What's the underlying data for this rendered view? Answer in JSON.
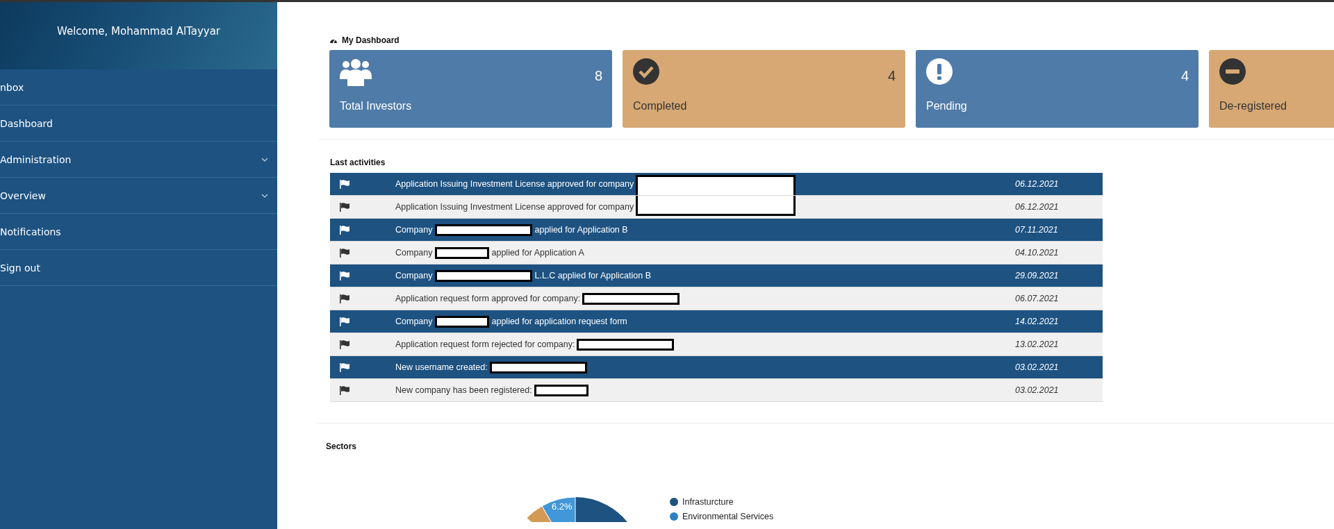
{
  "sidebar": {
    "welcome": "Welcome, Mohammad AlTayyar",
    "items": [
      {
        "label": "nbox",
        "has_submenu": false
      },
      {
        "label": "Dashboard",
        "has_submenu": false
      },
      {
        "label": "Administration",
        "has_submenu": true
      },
      {
        "label": "Overview",
        "has_submenu": true
      },
      {
        "label": "Notifications",
        "has_submenu": false
      },
      {
        "label": "Sign out",
        "has_submenu": false
      }
    ]
  },
  "dashboard": {
    "title": "My Dashboard",
    "cards": [
      {
        "kind": "users",
        "color": "#4f7ba8",
        "value": "8",
        "label": "Total Investors"
      },
      {
        "kind": "check",
        "color": "#d7a874",
        "value": "4",
        "label": "Completed"
      },
      {
        "kind": "alert",
        "color": "#4f7ba8",
        "value": "4",
        "label": "Pending"
      },
      {
        "kind": "minus",
        "color": "#d7a874",
        "label": "De-registered"
      }
    ]
  },
  "activities": {
    "title": "Last activities",
    "rows": [
      {
        "highlighted": true,
        "parts": [
          {
            "kind": "text",
            "text": "Application Issuing Investment License approved for company"
          },
          {
            "kind": "redacted-top"
          }
        ],
        "date": "06.12.2021"
      },
      {
        "highlighted": false,
        "parts": [
          {
            "kind": "text",
            "text": "Application Issuing Investment License approved for company"
          },
          {
            "kind": "redacted-bottom"
          }
        ],
        "date": "06.12.2021"
      },
      {
        "highlighted": true,
        "parts": [
          {
            "kind": "text",
            "text": "Company"
          },
          {
            "kind": "redacted"
          },
          {
            "kind": "text",
            "text": "applied for Application B"
          }
        ],
        "date": "07.11.2021"
      },
      {
        "highlighted": false,
        "parts": [
          {
            "kind": "text",
            "text": "Company"
          },
          {
            "kind": "redacted-short"
          },
          {
            "kind": "text",
            "text": "applied for Application A"
          }
        ],
        "date": "04.10.2021"
      },
      {
        "highlighted": true,
        "parts": [
          {
            "kind": "text",
            "text": "Company"
          },
          {
            "kind": "redacted"
          },
          {
            "kind": "text",
            "text": "L.L.C applied for Application B"
          }
        ],
        "date": "29.09.2021"
      },
      {
        "highlighted": false,
        "parts": [
          {
            "kind": "text",
            "text": "Application request form approved for company:"
          },
          {
            "kind": "redacted"
          }
        ],
        "date": "06.07.2021"
      },
      {
        "highlighted": true,
        "parts": [
          {
            "kind": "text",
            "text": "Company"
          },
          {
            "kind": "redacted-short"
          },
          {
            "kind": "text",
            "text": "applied for application request form"
          }
        ],
        "date": "14.02.2021"
      },
      {
        "highlighted": false,
        "parts": [
          {
            "kind": "text",
            "text": "Application request form rejected for company:"
          },
          {
            "kind": "redacted"
          }
        ],
        "date": "13.02.2021"
      },
      {
        "highlighted": true,
        "parts": [
          {
            "kind": "text",
            "text": "New username created:"
          },
          {
            "kind": "redacted"
          }
        ],
        "date": "03.02.2021"
      },
      {
        "highlighted": false,
        "parts": [
          {
            "kind": "text",
            "text": "New company has been registered:"
          },
          {
            "kind": "redacted-short"
          }
        ],
        "date": "03.02.2021"
      }
    ]
  },
  "sectors": {
    "title": "Sectors",
    "slice_label": "6.2%",
    "legend": [
      {
        "label": "Infrasturcture",
        "color": "#1d5281"
      },
      {
        "label": "Environmental Services",
        "color": "#2f7fc1"
      }
    ]
  }
}
